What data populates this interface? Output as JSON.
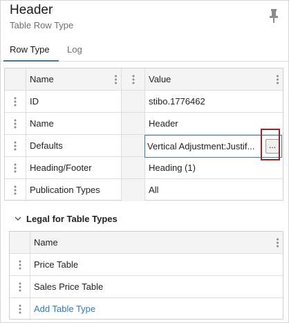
{
  "header": {
    "title": "Header",
    "subtitle": "Table Row Type"
  },
  "tabs": [
    {
      "label": "Row Type",
      "active": true
    },
    {
      "label": "Log",
      "active": false
    }
  ],
  "grid": {
    "columns": [
      "Name",
      "Value"
    ],
    "rows": [
      {
        "name": "ID",
        "value": "stibo.1776462"
      },
      {
        "name": "Name",
        "value": "Header"
      },
      {
        "name": "Defaults",
        "value": "Vertical Adjustment:Justif...",
        "button": "..."
      },
      {
        "name": "Heading/Footer",
        "value": "Heading (1)"
      },
      {
        "name": "Publication Types",
        "value": "All"
      }
    ]
  },
  "legal": {
    "title": "Legal for Table Types",
    "column": "Name",
    "rows": [
      "Price Table",
      "Sales Price Table"
    ],
    "add_label": "Add Table Type"
  },
  "colors": {
    "accent": "#3c78a8",
    "highlight": "#a61f24",
    "link": "#2f7cb8"
  }
}
